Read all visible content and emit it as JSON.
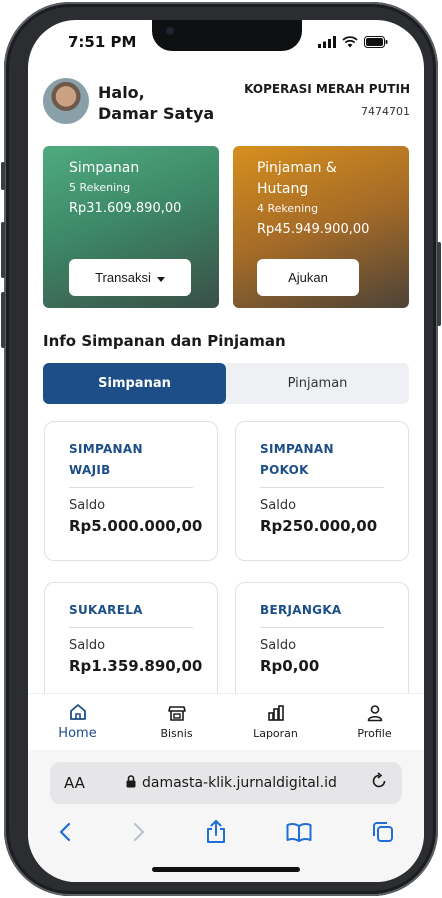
{
  "status_bar": {
    "time": "7:51 PM"
  },
  "header": {
    "greeting_line1": "Halo,",
    "greeting_line2": "Damar Satya",
    "org_name": "KOPERASI MERAH PUTIH",
    "org_id": "7474701"
  },
  "cards": {
    "savings": {
      "title": "Simpanan",
      "subtitle": "5 Rekening",
      "amount": "Rp31.609.890,00",
      "action": "Transaksi"
    },
    "loans": {
      "title_line1": "Pinjaman &",
      "title_line2": "Hutang",
      "subtitle": "4 Rekening",
      "amount": "Rp45.949.900,00",
      "action": "Ajukan"
    }
  },
  "section": {
    "title": "Info Simpanan dan Pinjaman",
    "tabs": [
      {
        "label": "Simpanan",
        "active": true
      },
      {
        "label": "Pinjaman",
        "active": false
      }
    ]
  },
  "accounts": [
    {
      "name_line1": "SIMPANAN",
      "name_line2": "WAJIB",
      "label": "Saldo",
      "amount": "Rp5.000.000,00"
    },
    {
      "name_line1": "SIMPANAN",
      "name_line2": "POKOK",
      "label": "Saldo",
      "amount": "Rp250.000,00"
    },
    {
      "name_line1": "SUKARELA",
      "name_line2": "",
      "label": "Saldo",
      "amount": "Rp1.359.890,00"
    },
    {
      "name_line1": "BERJANGKA",
      "name_line2": "",
      "label": "Saldo",
      "amount": "Rp0,00"
    }
  ],
  "bottom_nav": [
    {
      "label": "Home",
      "icon": "home-icon",
      "active": true
    },
    {
      "label": "Bisnis",
      "icon": "store-icon",
      "active": false
    },
    {
      "label": "Laporan",
      "icon": "bar-chart-icon",
      "active": false
    },
    {
      "label": "Profile",
      "icon": "user-icon",
      "active": false
    }
  ],
  "browser": {
    "aa_label": "AA",
    "url": "damasta-klik.jurnaldigital.id"
  },
  "colors": {
    "primary": "#1d4e88",
    "savings_card": "#4faa7f",
    "loans_card": "#d78f1e",
    "browser_accent": "#1f6fd6"
  }
}
